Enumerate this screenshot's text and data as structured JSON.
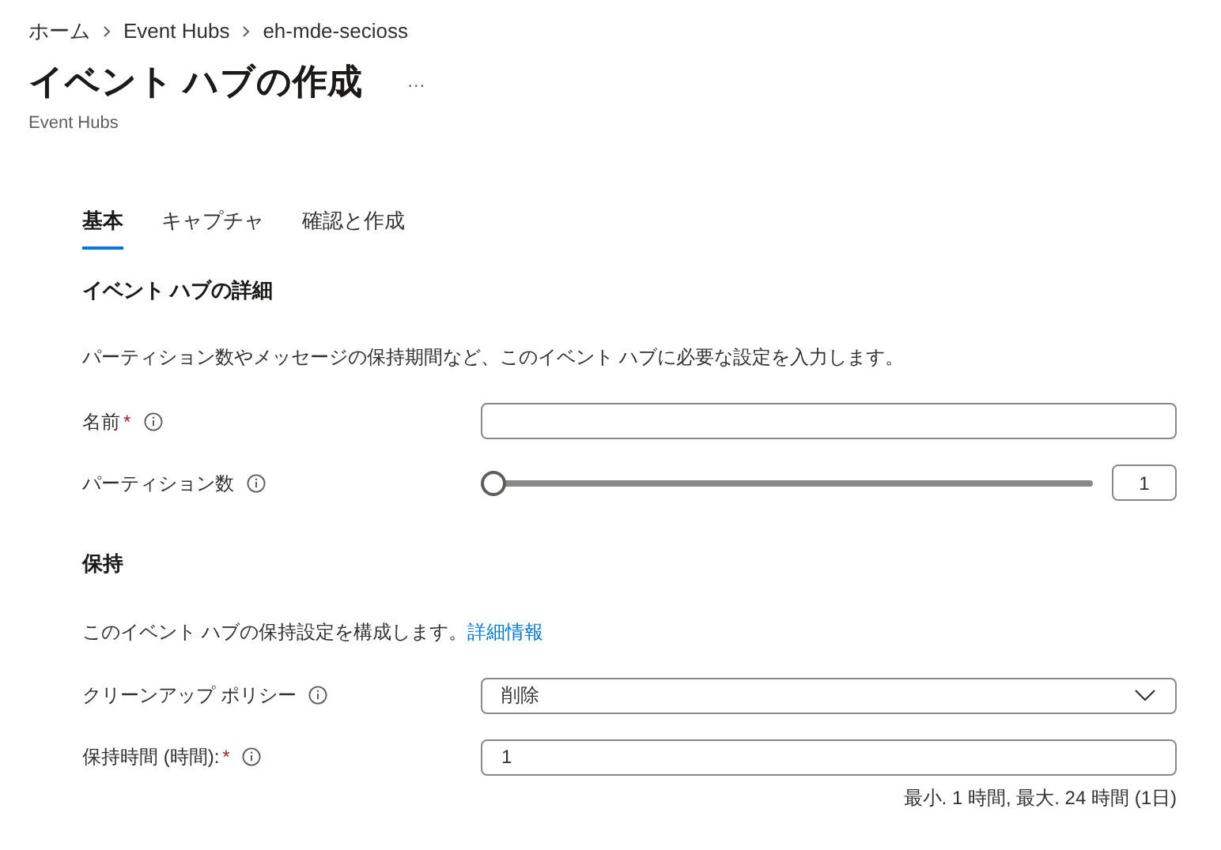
{
  "breadcrumb": [
    "ホーム",
    "Event Hubs",
    "eh-mde-secioss"
  ],
  "title": "イベント ハブの作成",
  "more": "…",
  "subtitle": "Event Hubs",
  "tabs": [
    {
      "label": "基本",
      "selected": true
    },
    {
      "label": "キャプチャ",
      "selected": false
    },
    {
      "label": "確認と作成",
      "selected": false
    }
  ],
  "sections": [
    {
      "heading": "イベント ハブの詳細",
      "description": "パーティション数やメッセージの保持期間など、このイベント ハブに必要な設定を入力します。",
      "fields": [
        {
          "kind": "text",
          "label": "名前",
          "required_mark": "*"
        },
        {
          "kind": "slider",
          "label": "パーティション数",
          "level": 0,
          "value": "1"
        }
      ]
    },
    {
      "heading": "保持",
      "description": "このイベント ハブの保持設定を構成します。",
      "link": "詳細情報",
      "fields": [
        {
          "kind": "select",
          "label": "クリーンアップ ポリシー",
          "value": "削除"
        },
        {
          "kind": "text",
          "label": "保持時間 (時間):",
          "required_mark": "*",
          "value": "1",
          "hint": "最小. 1 時間, 最大. 24 時間 (1日)"
        }
      ]
    }
  ]
}
